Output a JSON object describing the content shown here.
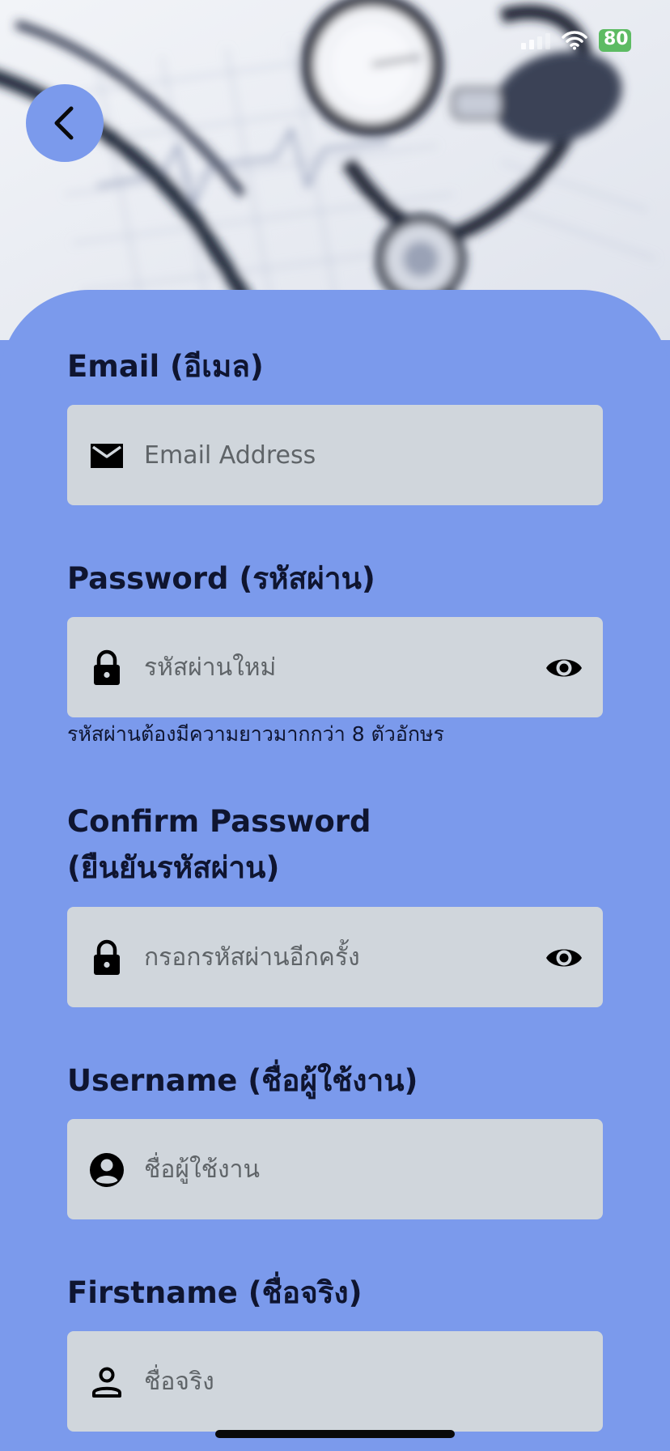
{
  "status_bar": {
    "battery": "80"
  },
  "header": {
    "back_icon": "chevron-left-icon",
    "image": "stethoscope-photo"
  },
  "form": {
    "email": {
      "label": "Email (อีเมล)",
      "placeholder": "Email Address",
      "icon": "mail-icon"
    },
    "password": {
      "label": "Password (รหัสผ่าน)",
      "placeholder": "รหัสผ่านใหม่",
      "icon": "lock-icon",
      "toggle_icon": "eye-icon",
      "hint": "รหัสผ่านต้องมีความยาวมากกว่า 8 ตัวอักษร"
    },
    "confirm_password": {
      "label_line1": "Confirm Password",
      "label_line2": "(ยืนยันรหัสผ่าน)",
      "placeholder": "กรอกรหัสผ่านอีกครั้ง",
      "icon": "lock-icon",
      "toggle_icon": "eye-icon"
    },
    "username": {
      "label": "Username (ชื่อผู้ใช้งาน)",
      "placeholder": "ชื่อผู้ใช้งาน",
      "icon": "account-circle-icon"
    },
    "firstname": {
      "label": "Firstname (ชื่อจริง)",
      "placeholder": "ชื่อจริง",
      "icon": "person-outline-icon"
    }
  },
  "colors": {
    "sheet": "#7b9aec",
    "field": "#d0d6dc",
    "label": "#0f1530",
    "battery": "#5dbb63"
  }
}
